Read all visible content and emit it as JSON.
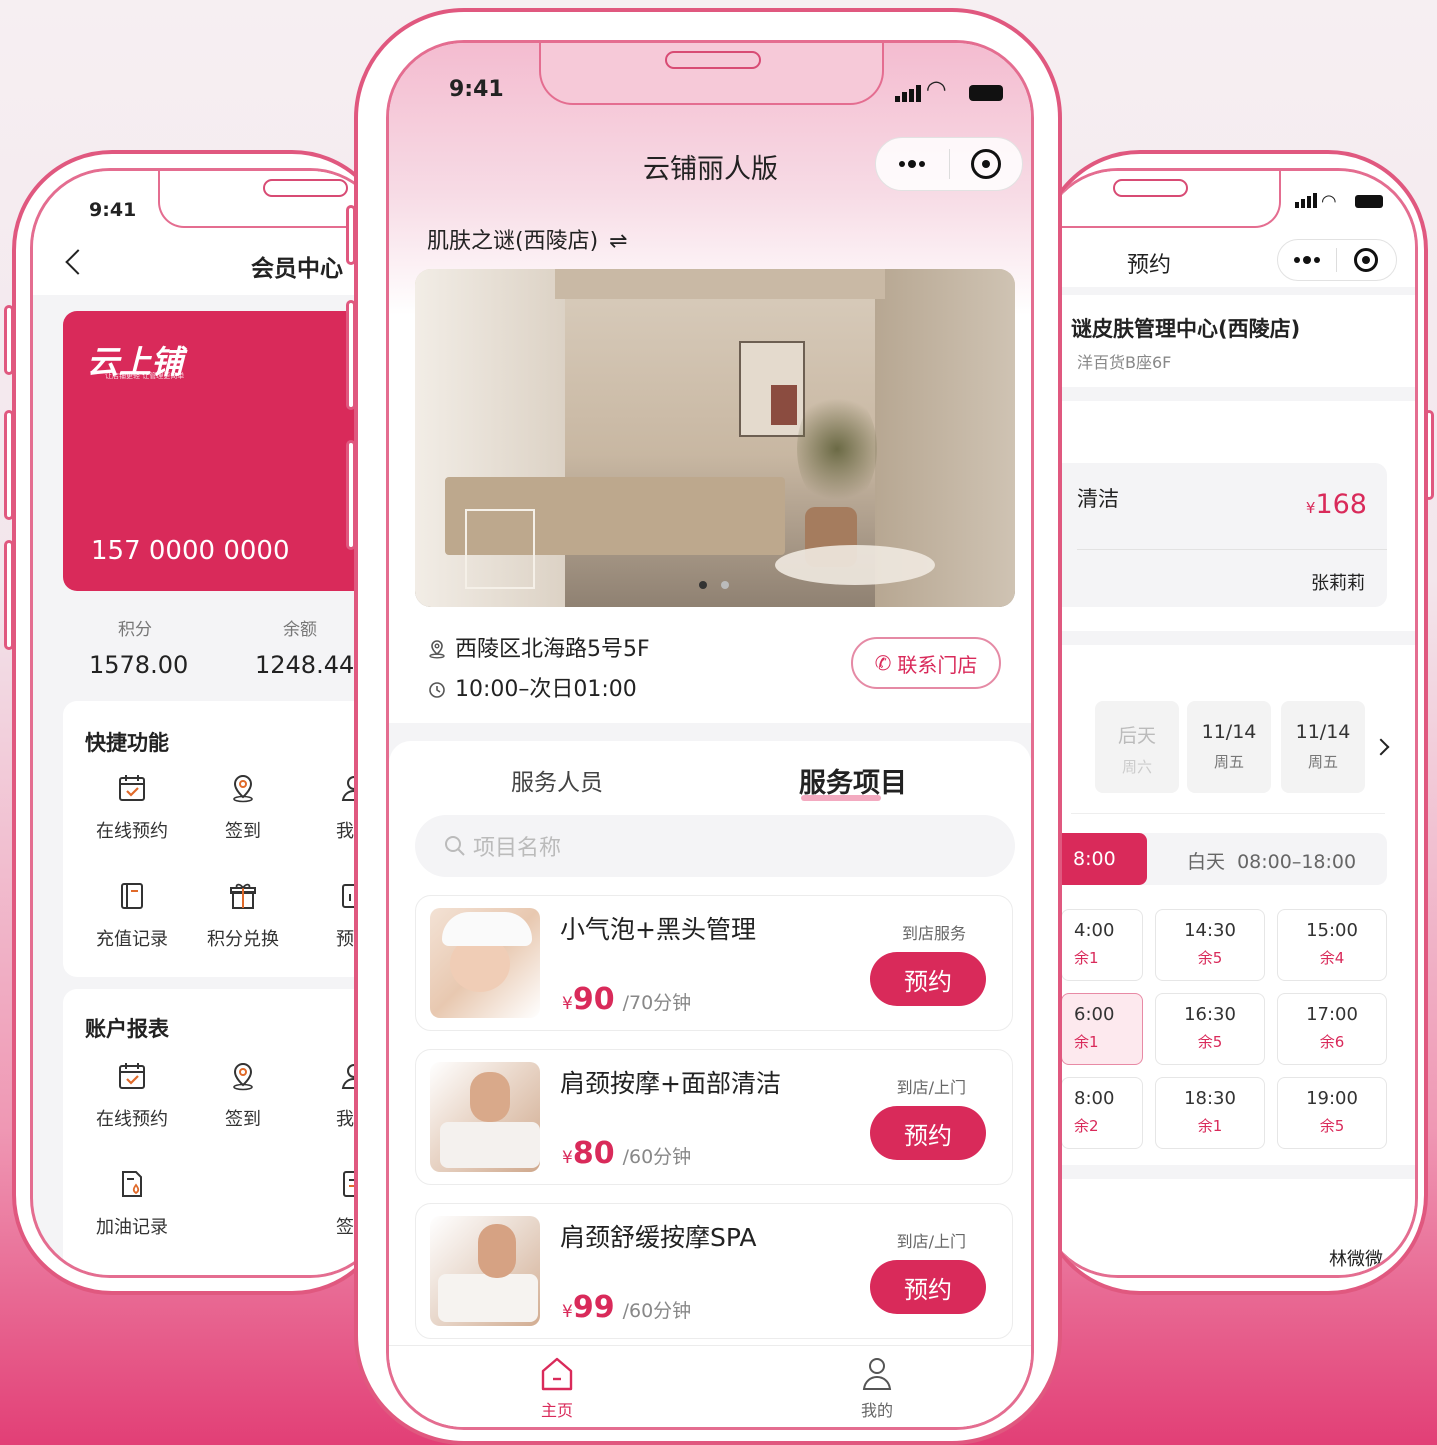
{
  "colors": {
    "accent": "#d92a5a",
    "frame": "#e0587f",
    "bg_bottom": "#e23f76"
  },
  "left_phone": {
    "time": "9:41",
    "title": "会员中心",
    "card": {
      "brand": "云上铺",
      "slogan": "让店铺更轻 让管理更简单",
      "phone": "157 0000 0000"
    },
    "stats": [
      {
        "label": "积分",
        "value": "1578.00"
      },
      {
        "label": "余额",
        "value": "1248.44"
      }
    ],
    "quick": {
      "title": "快捷功能",
      "items": [
        "在线预约",
        "签到",
        "我的",
        "充值记录",
        "积分兑换",
        "预约"
      ]
    },
    "report": {
      "title": "账户报表",
      "items": [
        "在线预约",
        "签到",
        "我的",
        "加油记录",
        "签到"
      ]
    }
  },
  "center_phone": {
    "time": "9:41",
    "title": "云铺丽人版",
    "store_name": "肌肤之谜(西陵店)",
    "switch_symbol": "⇌",
    "address": "西陵区北海路5号5F",
    "hours": "10:00–次日01:00",
    "contact_label": "联系门店",
    "tabs": [
      "服务人员",
      "服务项目"
    ],
    "active_tab": 1,
    "search_placeholder": "项目名称",
    "services": [
      {
        "title": "小气泡+黑头管理",
        "currency": "¥",
        "price": "90",
        "duration": "/70分钟",
        "tag": "到店服务",
        "button": "预约"
      },
      {
        "title": "肩颈按摩+面部清洁",
        "currency": "¥",
        "price": "80",
        "duration": "/60分钟",
        "tag": "到店/上门",
        "button": "预约"
      },
      {
        "title": "肩颈舒缓按摩SPA",
        "currency": "¥",
        "price": "99",
        "duration": "/60分钟",
        "tag": "到店/上门",
        "button": "预约"
      }
    ],
    "tabbar": [
      {
        "label": "主页",
        "icon": "home-icon",
        "active": true
      },
      {
        "label": "我的",
        "icon": "user-icon",
        "active": false
      }
    ]
  },
  "right_phone": {
    "title": "预约",
    "store_name": "谜皮肤管理中心(西陵店)",
    "store_addr": "洋百货B座6F",
    "service_name": "清洁",
    "currency": "¥",
    "price": "168",
    "staff": "张莉莉",
    "dates": [
      {
        "day": "后天",
        "weekday": "周六",
        "disabled": true
      },
      {
        "day": "11/14",
        "weekday": "周五",
        "disabled": false
      },
      {
        "day": "11/14",
        "weekday": "周五",
        "disabled": false
      }
    ],
    "period_active": "8:00",
    "period_other": "白天  08:00–18:00",
    "slots": [
      {
        "time": "4:00",
        "rem": "余1"
      },
      {
        "time": "14:30",
        "rem": "余5"
      },
      {
        "time": "15:00",
        "rem": "余4"
      },
      {
        "time": "6:00",
        "rem": "余1",
        "selected": true
      },
      {
        "time": "16:30",
        "rem": "余5"
      },
      {
        "time": "17:00",
        "rem": "余6"
      },
      {
        "time": "8:00",
        "rem": "余2"
      },
      {
        "time": "18:30",
        "rem": "余1"
      },
      {
        "time": "19:00",
        "rem": "余5"
      }
    ],
    "bottom_name": "林微微"
  }
}
